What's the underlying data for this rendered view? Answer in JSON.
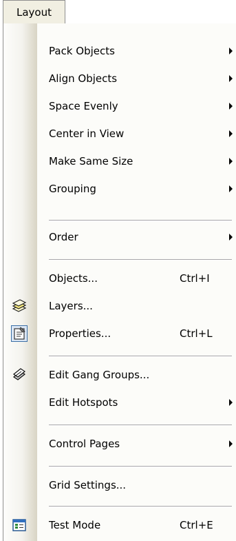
{
  "menubar": {
    "layout_label": "Layout"
  },
  "menu": {
    "items": [
      {
        "label": "Pack Objects",
        "submenu": true
      },
      {
        "label": "Align Objects",
        "submenu": true
      },
      {
        "label": "Space Evenly",
        "submenu": true
      },
      {
        "label": "Center in View",
        "submenu": true
      },
      {
        "label": "Make Same Size",
        "submenu": true
      },
      {
        "label": "Grouping",
        "submenu": true
      },
      {
        "label": "Order",
        "submenu": true
      },
      {
        "label": "Objects...",
        "shortcut": "Ctrl+I"
      },
      {
        "label": "Layers...",
        "icon": "layers-icon"
      },
      {
        "label": "Properties...",
        "shortcut": "Ctrl+L",
        "icon": "properties-icon"
      },
      {
        "label": "Edit Gang Groups...",
        "icon": "gang-groups-icon"
      },
      {
        "label": "Edit Hotspots",
        "submenu": true
      },
      {
        "label": "Control Pages",
        "submenu": true
      },
      {
        "label": "Grid Settings..."
      },
      {
        "label": "Test Mode",
        "shortcut": "Ctrl+E",
        "icon": "test-mode-icon"
      }
    ]
  },
  "colors": {
    "menu_bg": "#fcfcf9",
    "gutter_edge": "#d8d4c4",
    "separator": "#a7a6aa",
    "highlight_border": "#3a6ea5"
  }
}
